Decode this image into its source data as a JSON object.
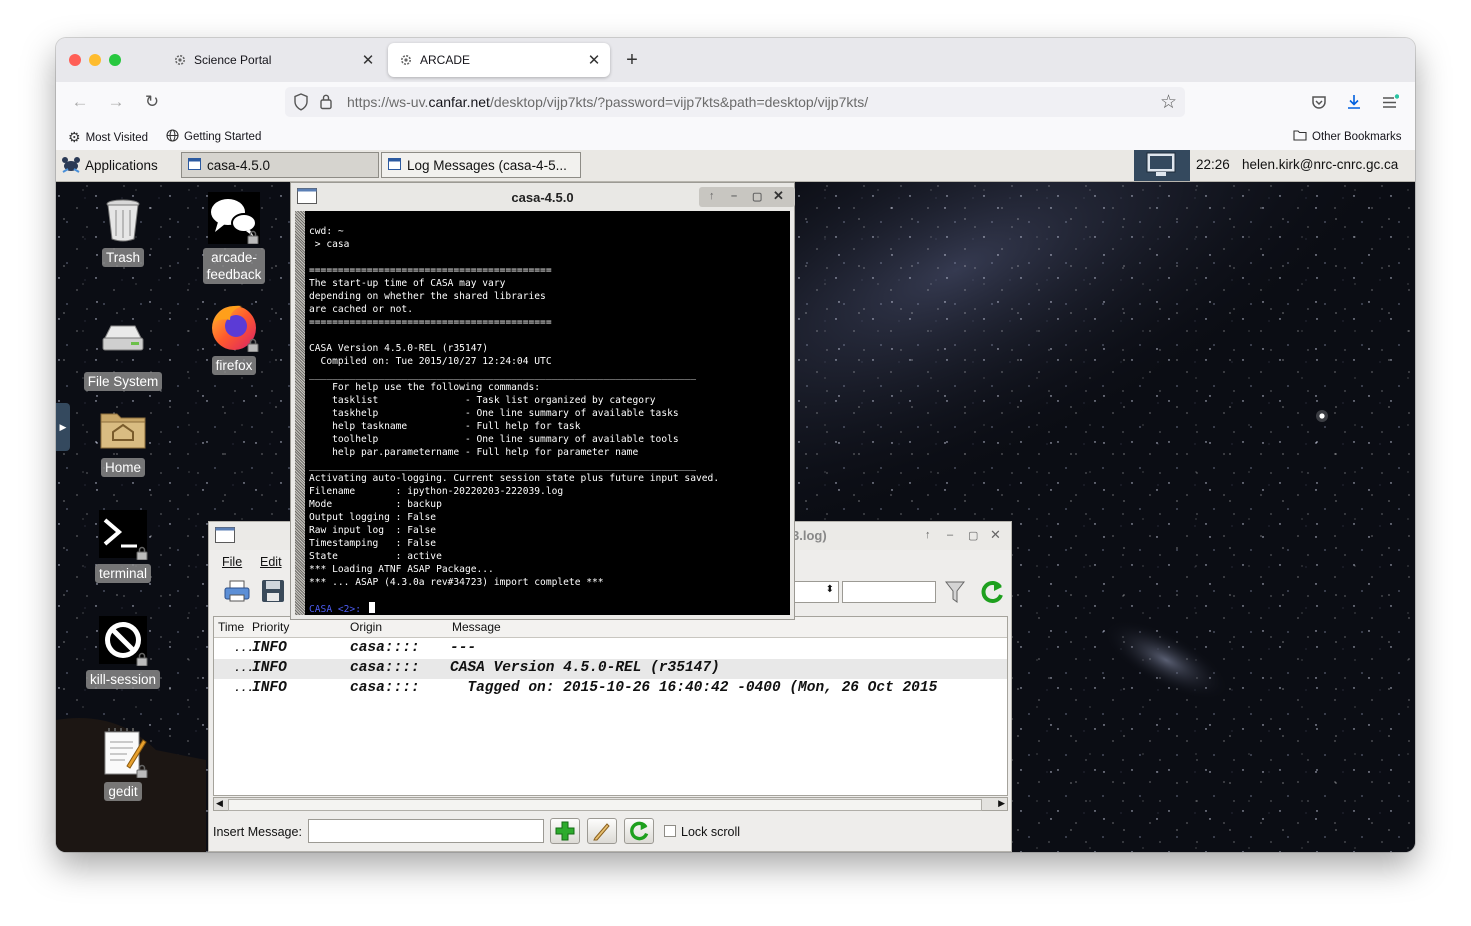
{
  "browser": {
    "tabs": [
      {
        "title": "Science Portal",
        "active": false
      },
      {
        "title": "ARCADE",
        "active": true
      }
    ],
    "url": {
      "prefix": "https://ws-uv.",
      "host": "canfar.net",
      "path": "/desktop/vijp7kts/?password=vijp7kts&path=desktop/vijp7kts/"
    },
    "bookmarks": {
      "most_visited": "Most Visited",
      "getting_started": "Getting Started",
      "other": "Other Bookmarks"
    }
  },
  "panel": {
    "applications": "Applications",
    "tasks": [
      "casa-4.5.0",
      "Log Messages (casa-4-5..."
    ],
    "clock": "22:26",
    "user": "helen.kirk@nrc-cnrc.gc.ca"
  },
  "desktop": {
    "icons": [
      {
        "label": "Trash",
        "icon": "trash-icon"
      },
      {
        "label": "arcade-\nfeedback",
        "icon": "chat-icon"
      },
      {
        "label": "File System",
        "icon": "drive-icon"
      },
      {
        "label": "firefox",
        "icon": "firefox-icon"
      },
      {
        "label": "Home",
        "icon": "home-folder-icon"
      },
      {
        "label": "terminal",
        "icon": "terminal-icon"
      },
      {
        "label": "kill-session",
        "icon": "forbidden-icon"
      },
      {
        "label": "gedit",
        "icon": "text-editor-icon"
      }
    ]
  },
  "terminal": {
    "title": "casa-4.5.0",
    "lines": [
      "cwd: ~",
      " > casa",
      "",
      "==========================================",
      "The start-up time of CASA may vary",
      "depending on whether the shared libraries",
      "are cached or not.",
      "==========================================",
      "",
      "CASA Version 4.5.0-REL (r35147)",
      "  Compiled on: Tue 2015/10/27 12:24:04 UTC",
      "___________________________________________________________________",
      "    For help use the following commands:",
      "    tasklist               - Task list organized by category",
      "    taskhelp               - One line summary of available tasks",
      "    help taskname          - Full help for task",
      "    toolhelp               - One line summary of available tools",
      "    help par.parametername - Full help for parameter name",
      "___________________________________________________________________",
      "Activating auto-logging. Current session state plus future input saved.",
      "Filename       : ipython-20220203-222039.log",
      "Mode           : backup",
      "Output logging : False",
      "Raw input log  : False",
      "Timestamping   : False",
      "State          : active",
      "*** Loading ATNF ASAP Package...",
      "*** ... ASAP (4.3.0a rev#34723) import complete ***"
    ],
    "prompt": "CASA <2>:"
  },
  "logger": {
    "title_fragment": "3.log)",
    "menu": [
      "File",
      "Edit"
    ],
    "columns": [
      "Time",
      "Priority",
      "Origin",
      "Message"
    ],
    "rows": [
      {
        "time": "...",
        "priority": "INFO",
        "origin": "casa::::",
        "message": "---"
      },
      {
        "time": "...",
        "priority": "INFO",
        "origin": "casa::::",
        "message": "CASA Version 4.5.0-REL (r35147)"
      },
      {
        "time": "...",
        "priority": "INFO",
        "origin": "casa::::",
        "message": "  Tagged on: 2015-10-26 16:40:42 -0400 (Mon, 26 Oct 2015"
      }
    ],
    "insert_label": "Insert Message:",
    "insert_value": "",
    "lock_scroll": "Lock scroll"
  },
  "colors": {
    "desktop_bg": "#0b0d14",
    "prompt_blue": "#4c5cf0",
    "refresh_green": "#1ea01e",
    "download_blue": "#0060df"
  }
}
